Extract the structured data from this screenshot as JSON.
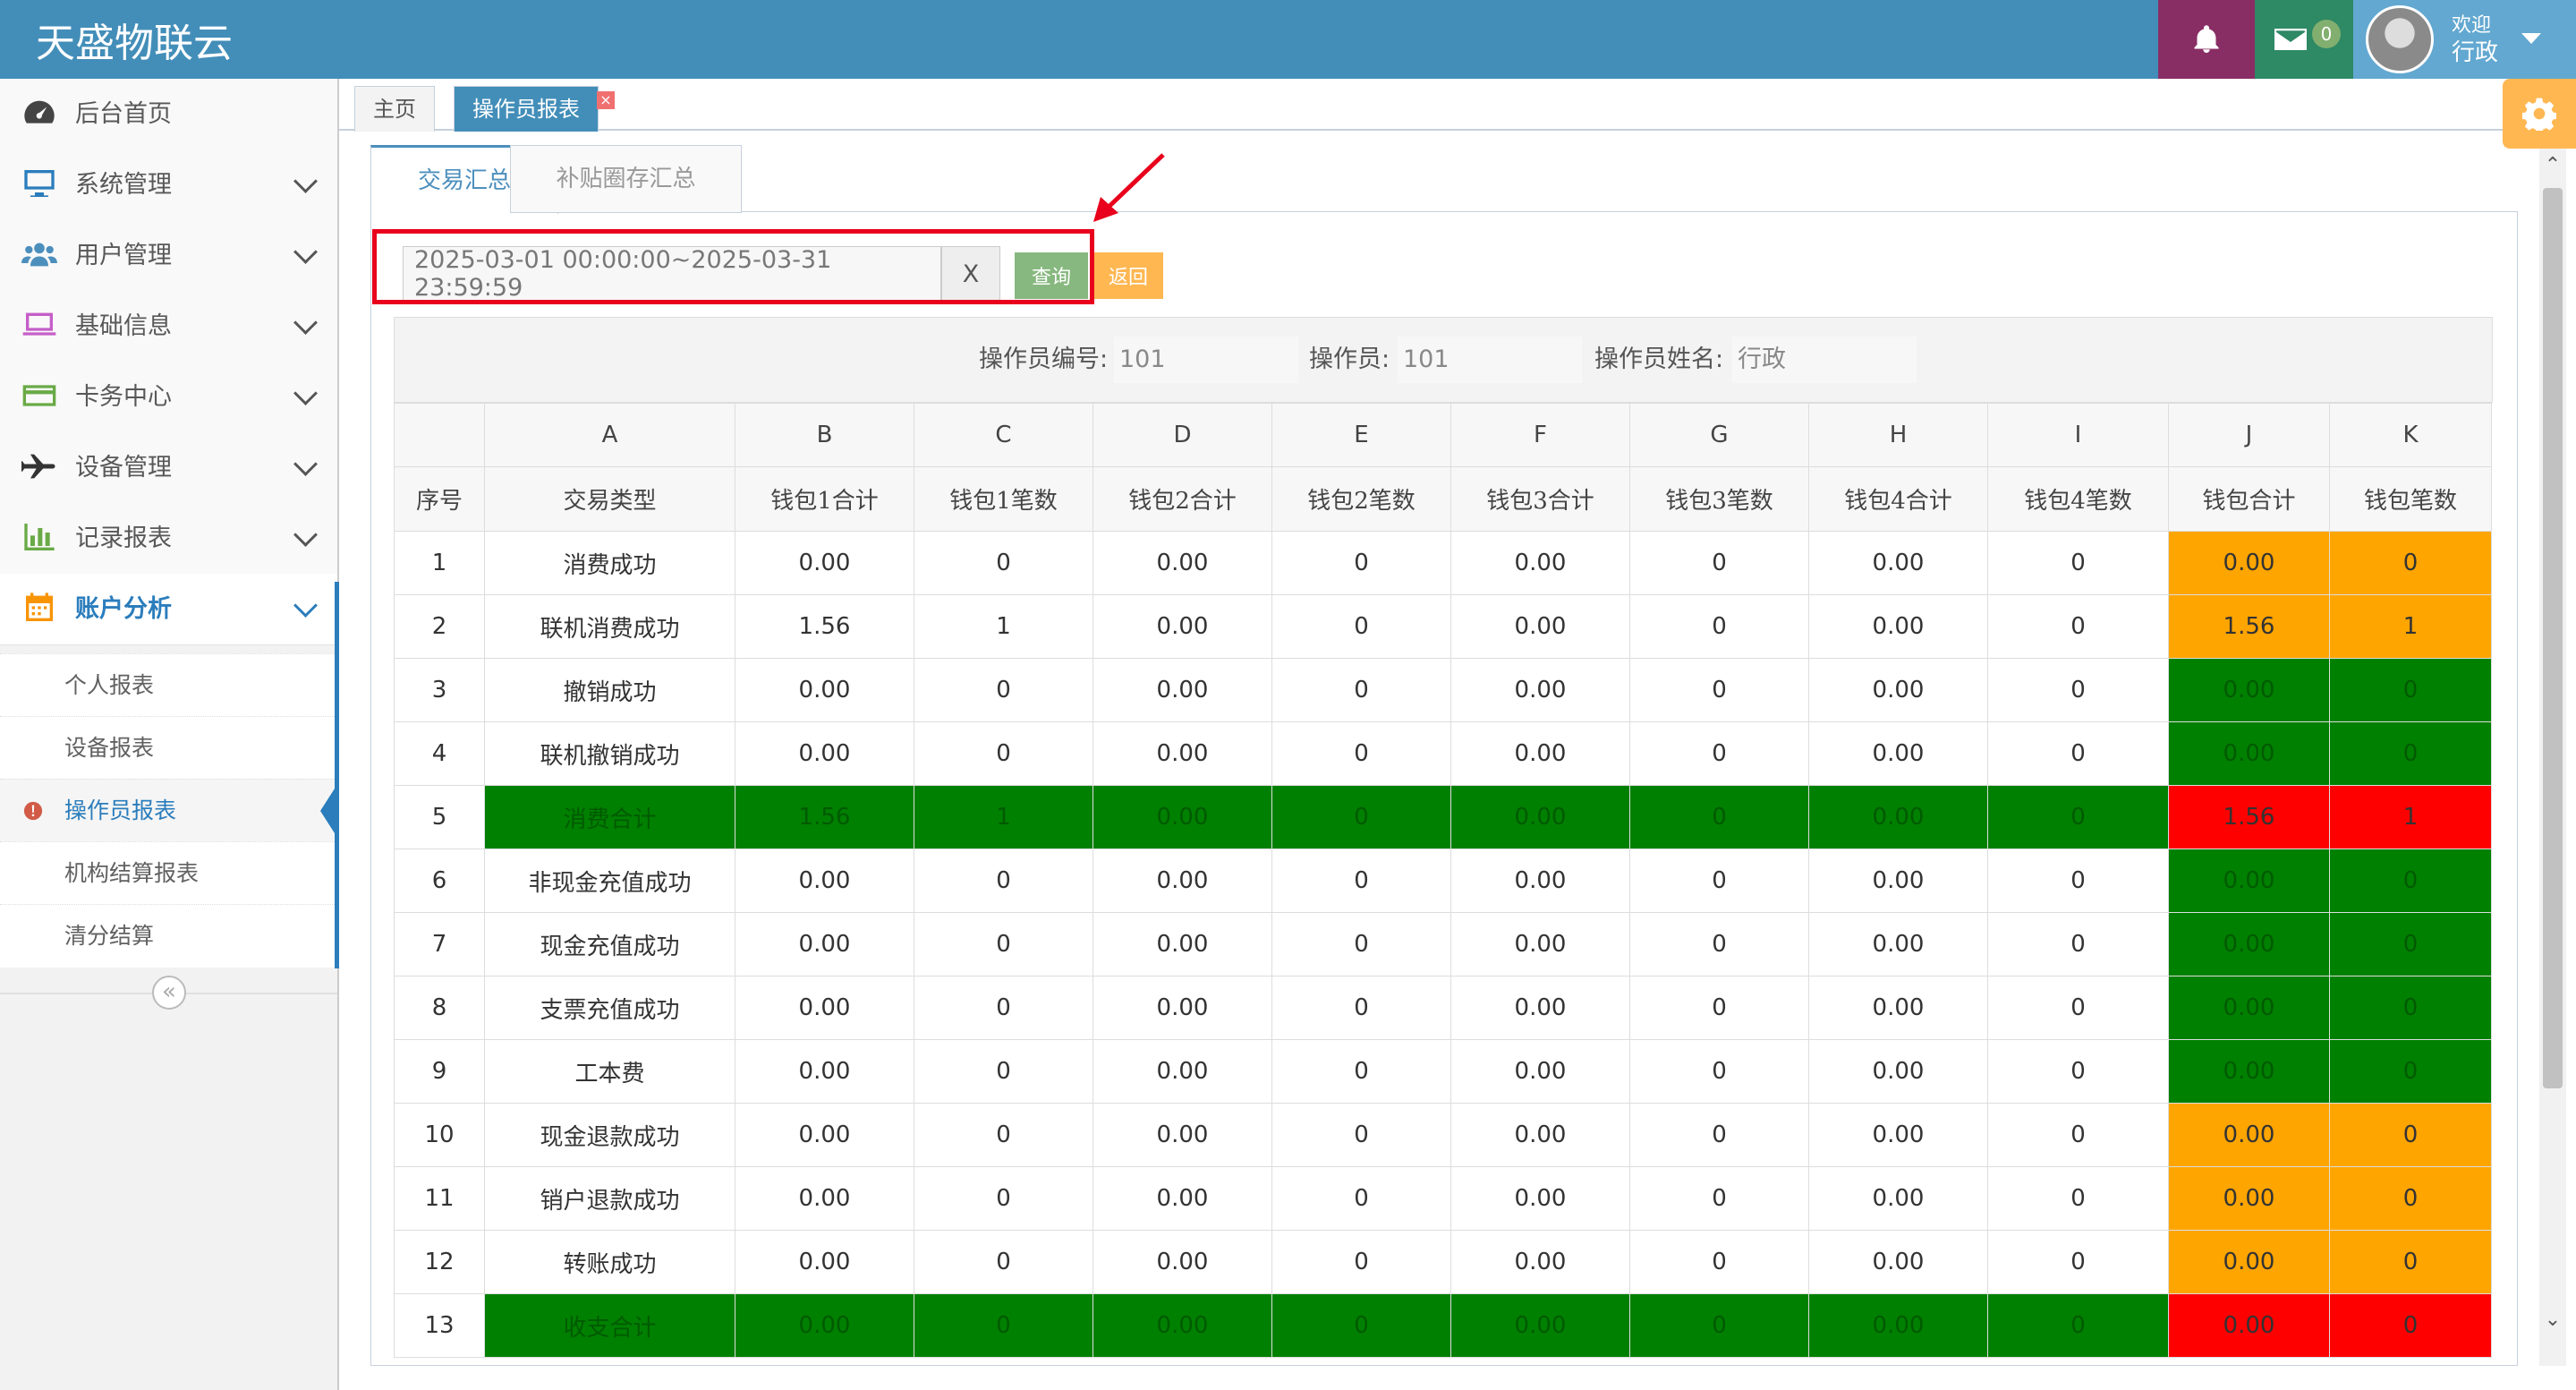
{
  "app": {
    "title": "天盛物联云"
  },
  "user": {
    "welcome": "欢迎",
    "name": "行政",
    "mail_count": "0"
  },
  "sidebar": {
    "items": [
      {
        "label": "后台首页",
        "icon": "dashboard-icon"
      },
      {
        "label": "系统管理",
        "icon": "desktop-icon"
      },
      {
        "label": "用户管理",
        "icon": "users-icon"
      },
      {
        "label": "基础信息",
        "icon": "laptop-icon"
      },
      {
        "label": "卡务中心",
        "icon": "credit-card-icon"
      },
      {
        "label": "设备管理",
        "icon": "plane-icon"
      },
      {
        "label": "记录报表",
        "icon": "bar-chart-icon"
      },
      {
        "label": "账户分析",
        "icon": "calendar-icon"
      }
    ],
    "subitems": [
      "个人报表",
      "设备报表",
      "操作员报表",
      "机构结算报表",
      "清分结算"
    ]
  },
  "tabs": {
    "home": "主页",
    "operator_report": "操作员报表",
    "close": "×"
  },
  "inner_tabs": {
    "tx_summary": "交易汇总",
    "subsidy_summary": "补贴圈存汇总"
  },
  "query": {
    "date_range": "2025-03-01 00:00:00~2025-03-31 23:59:59",
    "clear": "X",
    "search": "查询",
    "back": "返回"
  },
  "info": {
    "op_code_label": "操作员编号:",
    "op_code": "101",
    "op_label": "操作员:",
    "op": "101",
    "op_name_label": "操作员姓名:",
    "op_name": "行政"
  },
  "table": {
    "letters": [
      "",
      "A",
      "B",
      "C",
      "D",
      "E",
      "F",
      "G",
      "H",
      "I",
      "J",
      "K"
    ],
    "headers": [
      "序号",
      "交易类型",
      "钱包1合计",
      "钱包1笔数",
      "钱包2合计",
      "钱包2笔数",
      "钱包3合计",
      "钱包3笔数",
      "钱包4合计",
      "钱包4笔数",
      "钱包合计",
      "钱包笔数"
    ],
    "rows": [
      {
        "cells": [
          "1",
          "消费成功",
          "0.00",
          "0",
          "0.00",
          "0",
          "0.00",
          "0",
          "0.00",
          "0",
          "0.00",
          "0"
        ],
        "style": "normal",
        "tail": "orange"
      },
      {
        "cells": [
          "2",
          "联机消费成功",
          "1.56",
          "1",
          "0.00",
          "0",
          "0.00",
          "0",
          "0.00",
          "0",
          "1.56",
          "1"
        ],
        "style": "normal",
        "tail": "orange"
      },
      {
        "cells": [
          "3",
          "撤销成功",
          "0.00",
          "0",
          "0.00",
          "0",
          "0.00",
          "0",
          "0.00",
          "0",
          "0.00",
          "0"
        ],
        "style": "normal",
        "tail": "green"
      },
      {
        "cells": [
          "4",
          "联机撤销成功",
          "0.00",
          "0",
          "0.00",
          "0",
          "0.00",
          "0",
          "0.00",
          "0",
          "0.00",
          "0"
        ],
        "style": "normal",
        "tail": "green"
      },
      {
        "cells": [
          "5",
          "消费合计",
          "1.56",
          "1",
          "0.00",
          "0",
          "0.00",
          "0",
          "0.00",
          "0",
          "1.56",
          "1"
        ],
        "style": "total",
        "tail": "red"
      },
      {
        "cells": [
          "6",
          "非现金充值成功",
          "0.00",
          "0",
          "0.00",
          "0",
          "0.00",
          "0",
          "0.00",
          "0",
          "0.00",
          "0"
        ],
        "style": "normal",
        "tail": "green"
      },
      {
        "cells": [
          "7",
          "现金充值成功",
          "0.00",
          "0",
          "0.00",
          "0",
          "0.00",
          "0",
          "0.00",
          "0",
          "0.00",
          "0"
        ],
        "style": "normal",
        "tail": "green"
      },
      {
        "cells": [
          "8",
          "支票充值成功",
          "0.00",
          "0",
          "0.00",
          "0",
          "0.00",
          "0",
          "0.00",
          "0",
          "0.00",
          "0"
        ],
        "style": "normal",
        "tail": "green"
      },
      {
        "cells": [
          "9",
          "工本费",
          "0.00",
          "0",
          "0.00",
          "0",
          "0.00",
          "0",
          "0.00",
          "0",
          "0.00",
          "0"
        ],
        "style": "normal",
        "tail": "green"
      },
      {
        "cells": [
          "10",
          "现金退款成功",
          "0.00",
          "0",
          "0.00",
          "0",
          "0.00",
          "0",
          "0.00",
          "0",
          "0.00",
          "0"
        ],
        "style": "normal",
        "tail": "orange"
      },
      {
        "cells": [
          "11",
          "销户退款成功",
          "0.00",
          "0",
          "0.00",
          "0",
          "0.00",
          "0",
          "0.00",
          "0",
          "0.00",
          "0"
        ],
        "style": "normal",
        "tail": "orange"
      },
      {
        "cells": [
          "12",
          "转账成功",
          "0.00",
          "0",
          "0.00",
          "0",
          "0.00",
          "0",
          "0.00",
          "0",
          "0.00",
          "0"
        ],
        "style": "normal",
        "tail": "orange"
      },
      {
        "cells": [
          "13",
          "收支合计",
          "0.00",
          "0",
          "0.00",
          "0",
          "0.00",
          "0",
          "0.00",
          "0",
          "0.00",
          "0"
        ],
        "style": "total",
        "tail": "red"
      }
    ]
  },
  "colors": {
    "topbar": "#438eb9",
    "accent_blue": "#2b7dbc",
    "total_green": "#008000",
    "tail_orange": "#ffa500",
    "tail_red": "#ff0000",
    "highlight_red": "#e8001c"
  }
}
